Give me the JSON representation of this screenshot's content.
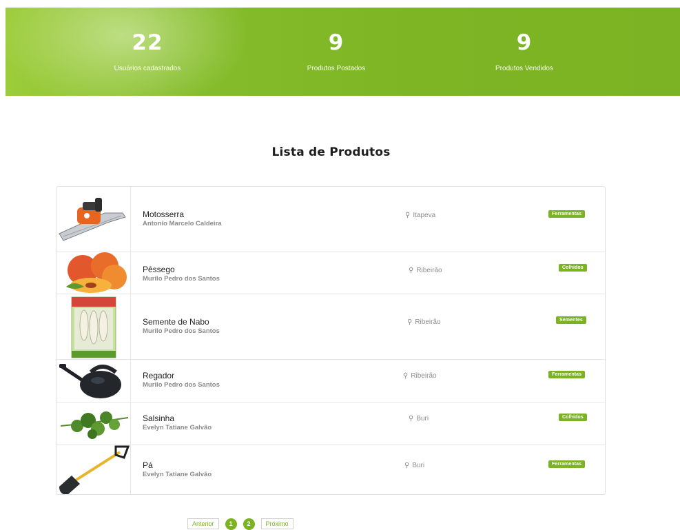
{
  "stats": [
    {
      "value": "22",
      "label": "Usuários cadastrados"
    },
    {
      "value": "9",
      "label": "Produtos Postados"
    },
    {
      "value": "9",
      "label": "Produtos Vendidos"
    }
  ],
  "section_title": "Lista de Produtos",
  "products": [
    {
      "name": "Motosserra",
      "seller": "Antonio Marcelo Caldeira",
      "location": "Itapeva",
      "category": "Ferramentas",
      "image": "chainsaw-image"
    },
    {
      "name": "Pêssego",
      "seller": "Murilo Pedro dos Santos",
      "location": "Ribeirão",
      "category": "Colhidos",
      "image": "peach-image"
    },
    {
      "name": "Semente de Nabo",
      "seller": "Murilo Pedro dos Santos",
      "location": "Ribeirão",
      "category": "Sementes",
      "image": "seed-packet-image"
    },
    {
      "name": "Regador",
      "seller": "Murilo Pedro dos Santos",
      "location": "Ribeirão",
      "category": "Ferramentas",
      "image": "watering-can-image"
    },
    {
      "name": "Salsinha",
      "seller": "Evelyn Tatiane Galvão",
      "location": "Buri",
      "category": "Colhidos",
      "image": "parsley-image"
    },
    {
      "name": "Pá",
      "seller": "Evelyn Tatiane Galvão",
      "location": "Buri",
      "category": "Ferramentas",
      "image": "shovel-image"
    }
  ],
  "pagination": {
    "prev_label": "Anterior",
    "pages": [
      "1",
      "2"
    ],
    "next_label": "Próximo"
  },
  "colors": {
    "accent": "#7cb324",
    "banner": "#86bd2c"
  }
}
